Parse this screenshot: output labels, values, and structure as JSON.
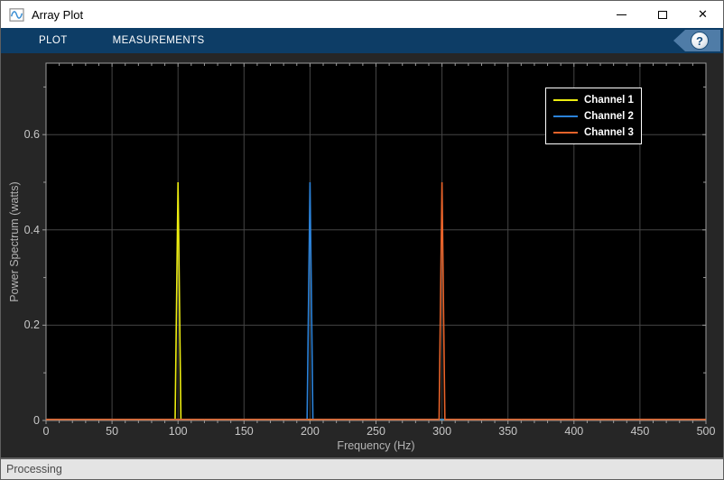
{
  "window": {
    "title": "Array Plot",
    "controls": {
      "close_glyph": "✕"
    }
  },
  "toolbar": {
    "tabs": [
      {
        "label": "PLOT"
      },
      {
        "label": "MEASUREMENTS"
      }
    ],
    "help_label": "?"
  },
  "status_bar": {
    "text": "Processing"
  },
  "chart_data": {
    "type": "line",
    "title": "",
    "xlabel": "Frequency (Hz)",
    "ylabel": "Power Spectrum (watts)",
    "xlim": [
      0,
      500
    ],
    "ylim": [
      0,
      0.75
    ],
    "x_major_ticks": [
      0,
      50,
      100,
      150,
      200,
      250,
      300,
      350,
      400,
      450,
      500
    ],
    "x_minor_step": 10,
    "y_major_ticks": [
      0,
      0.2,
      0.4,
      0.6
    ],
    "y_minor_step": 0.1,
    "grid": true,
    "legend_position": "northeast",
    "series": [
      {
        "name": "Channel 1",
        "color": "#eded10",
        "peak_hz": 100,
        "peak_watts": 0.5,
        "baseline_watts": 0.002,
        "peak_halfwidth_hz": 2.2
      },
      {
        "name": "Channel 2",
        "color": "#2b82d9",
        "peak_hz": 200,
        "peak_watts": 0.5,
        "baseline_watts": 0.002,
        "peak_halfwidth_hz": 2.2
      },
      {
        "name": "Channel 3",
        "color": "#e8632a",
        "peak_hz": 300,
        "peak_watts": 0.5,
        "baseline_watts": 0.002,
        "peak_halfwidth_hz": 2.2
      }
    ],
    "colors": {
      "figure_background": "#262626",
      "axes_background": "#000000",
      "grid_color": "#454545",
      "axis_color": "#9c9c9c",
      "tick_label_color": "#c7c7c7",
      "axis_label_color": "#b4b4b4"
    }
  }
}
